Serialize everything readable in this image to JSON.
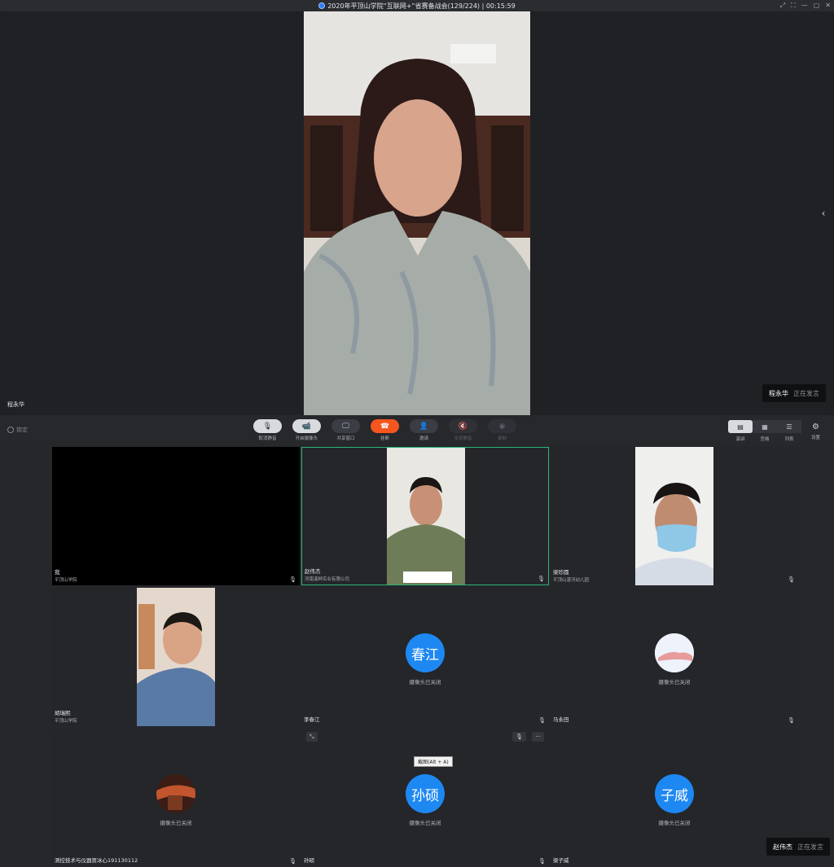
{
  "window": {
    "title": "2020年平顶山学院“互联网+”省赛备战会(129/224) | 00:15:59",
    "controls": [
      "⤢",
      "⛶",
      "—",
      "▢",
      "✕"
    ]
  },
  "stage": {
    "speaker_name": "程永华",
    "collapse_glyph": "‹",
    "speaking": {
      "name": "程永华",
      "status": "正在发言"
    }
  },
  "toolbar": {
    "lock_label": "锁定",
    "buttons": [
      {
        "icon": "🎙",
        "label": "取消静音"
      },
      {
        "icon": "📹",
        "label": "开启摄像头"
      },
      {
        "icon": "🖵",
        "label": "共享窗口"
      },
      {
        "icon": "☎",
        "label": "挂断"
      },
      {
        "icon": "👤",
        "label": "邀请"
      },
      {
        "icon": "🔇",
        "label": "全员静音"
      },
      {
        "icon": "◉",
        "label": "录制"
      }
    ],
    "views": [
      {
        "icon": "▤",
        "label": "演讲"
      },
      {
        "icon": "▦",
        "label": "宫格"
      },
      {
        "icon": "☰",
        "label": "列表"
      }
    ],
    "settings_icon": "⚙",
    "settings_label": "设置"
  },
  "gallery": {
    "cam_off_text": "摄像头已关闭",
    "mic_glyph": "🎙",
    "tiles": [
      {
        "name": "我",
        "org": "平顶山学院"
      },
      {
        "name": "赵伟杰",
        "org": "河南溪畔实业有限公司"
      },
      {
        "name": "梁珍圆",
        "org": "平顶山湛河幼儿园"
      },
      {
        "name": "胡瑞熙",
        "org": "平顶山学院"
      },
      {
        "name": "李春江",
        "avatar": "春江"
      },
      {
        "name": "马永田"
      },
      {
        "name": "测控技术与仪器贾冰心191130112"
      },
      {
        "name": "孙硕",
        "avatar": "孙硕",
        "tooltip": "截图(Alt + A)",
        "expand_glyph": "⤡",
        "more_glyph": "···"
      },
      {
        "name": "梁子威",
        "avatar": "子威"
      }
    ],
    "speaking": {
      "name": "赵伟杰",
      "status": "正在发言"
    }
  }
}
